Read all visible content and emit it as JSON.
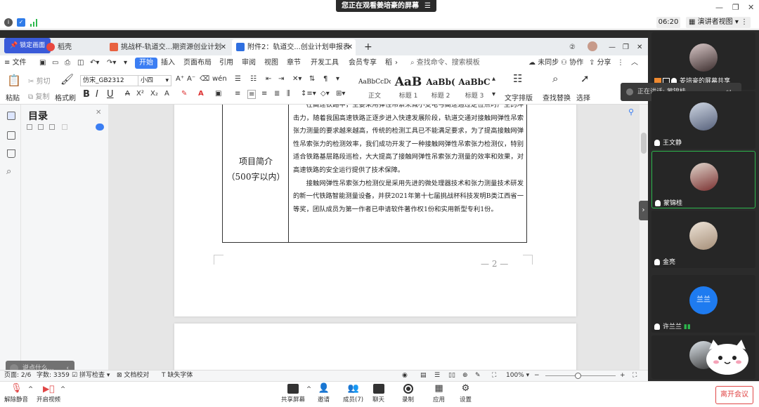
{
  "meeting": {
    "share_banner": "您正在观看姜培豪的屏幕",
    "timer": "06:20",
    "presenter_view": "演讲者视图",
    "speaking": "正在讲话: 蒙锦桂",
    "participants": [
      {
        "name": "姜培豪的屏幕共享"
      },
      {
        "name": "王文静"
      },
      {
        "name": "蒙锦桂"
      },
      {
        "name": "金亮"
      },
      {
        "name": "许兰兰",
        "avatar_text": "兰兰"
      },
      {
        "name": ""
      }
    ],
    "toolbar": {
      "mute": "解除静音",
      "video": "开启视频",
      "share": "共享屏幕",
      "invite": "邀请",
      "members": "成员(7)",
      "chat": "聊天",
      "record": "录制",
      "apps": "应用",
      "settings": "设置",
      "leave": "离开会议"
    }
  },
  "wps": {
    "pin_tab": "锁定画面",
    "tabs": [
      "稻壳",
      "挑战杯-轨道交...期资源创业计划",
      "附件2：轨道交...创业计划申报表"
    ],
    "menu": {
      "file": "文件",
      "start": "开始",
      "items": [
        "插入",
        "页面布局",
        "引用",
        "审阅",
        "视图",
        "章节",
        "开发工具",
        "会员专享",
        "稻"
      ],
      "search": "查找命令、搜索模板",
      "sync": "未同步",
      "collab": "协作",
      "share": "分享"
    },
    "ribbon": {
      "paste": "粘贴",
      "cut": "剪切",
      "copy": "复制",
      "format_painter": "格式刷",
      "font": "仿宋_GB2312",
      "size": "小四",
      "styles": [
        {
          "preview": "AaBbCcDd",
          "label": "正文"
        },
        {
          "preview": "AaB",
          "label": "标题 1"
        },
        {
          "preview": "AaBb(",
          "label": "标题 2"
        },
        {
          "preview": "AaBbC",
          "label": "标题 3"
        }
      ],
      "text_layout": "文字排版",
      "find_replace": "查找替换",
      "select": "选择"
    },
    "toc_title": "目录",
    "document": {
      "label_line1": "项目简介",
      "label_line2": "（500字以内）",
      "para1": "在高速铁路中，主要采用弹性吊索来减小受电弓高速通过定位点时产生的冲击力，随着我国高速铁路正逐步进入快速发展阶段，轨道交通对接触网弹性吊索张力测量的要求越来越高，传统的检测工具已不能满足要求，为了提高接触网弹性吊索张力的检测效率，我们成功开发了一种接触网弹性吊索张力检测仪，特别适合铁路基层路段巡检，大大提高了接触网弹性吊索张力测量的效率和效果，对高速铁路的安全运行提供了技术保障。",
      "para2": "接触网弹性吊索张力检测仪是采用先进的微处理器技术和张力测量技术研发的新一代铁路智能测量设备，并获2021年第十七届挑战杯科技发明B类江西省一等奖，团队成员为第一作者已申请软件著作权1份和实用新型专利1份。",
      "page_number": "— 2 —"
    },
    "comment_placeholder": "说点什么...",
    "status": {
      "page": "页面: 2/6",
      "words": "字数: 3359",
      "spell": "拼写检查",
      "proof": "文档校对",
      "missing_font": "缺失字体",
      "zoom": "100%"
    }
  }
}
